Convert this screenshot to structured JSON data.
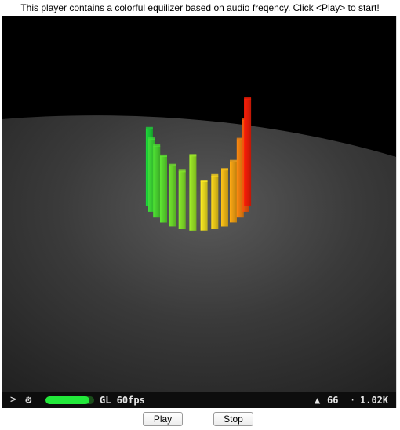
{
  "instructions": "This player contains a colorful equilizer based on audio freqency. Click <Play> to start!",
  "equalizer": {
    "levels": [
      0.72,
      0.68,
      0.67,
      0.62,
      0.57,
      0.54,
      0.7,
      0.46,
      0.5,
      0.53,
      0.57,
      0.73,
      0.86,
      1.0
    ],
    "colors": [
      "#1dd93a",
      "#3ee038",
      "#4fe334",
      "#60e832",
      "#74eb2e",
      "#8aee2b",
      "#a3f228",
      "#ffee22",
      "#ffd91c",
      "#ffc418",
      "#ffaa14",
      "#ff8a10",
      "#ff5c0c",
      "#ff1f08"
    ]
  },
  "statusbar": {
    "chevron": ">",
    "gear_icon": "⚙",
    "renderer_level": 0.9,
    "renderer_label": "GL 60fps",
    "triangle_icon": "▲",
    "triangle_count": "66",
    "dot": "·",
    "size": "1.02K"
  },
  "buttons": {
    "play_label": "Play",
    "stop_label": "Stop"
  }
}
